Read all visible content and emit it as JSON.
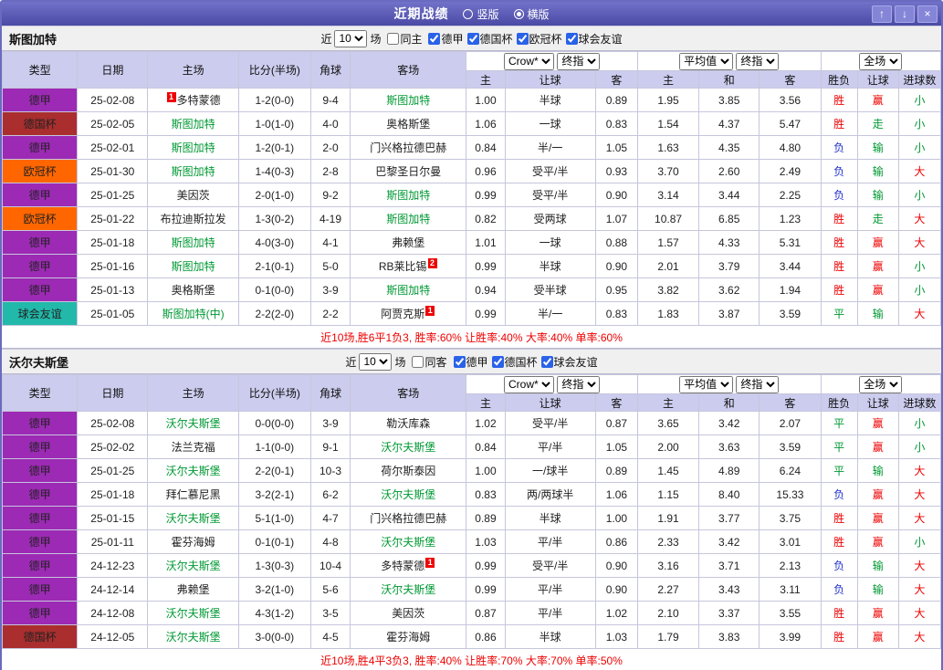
{
  "titlebar": {
    "title": "近期战绩",
    "vertical": "竖版",
    "horizontal": "横版",
    "up": "↑",
    "down": "↓",
    "close": "×"
  },
  "colors": {
    "red": "#ee0000",
    "green": "#009933",
    "blue": "#2233cc",
    "header_lavender": "#ccccee",
    "frame_purple": "#6a6ac0",
    "league": {
      "德甲": "#9c2ab4",
      "德国杯": "#aa2e2e",
      "欧冠杯": "#ff6600",
      "球会友谊": "#22b8aa"
    },
    "result_map": {
      "胜": "#ee0000",
      "平": "#009933",
      "负": "#2233cc",
      "赢": "#ee0000",
      "走": "#009933",
      "输": "#009933",
      "大": "#ee0000",
      "小": "#009933"
    }
  },
  "sections": [
    {
      "team": "斯图加特",
      "filter": {
        "near": "近",
        "count": "10",
        "games": "场",
        "venue": "同主",
        "venue_checked": false,
        "leagues": [
          "德甲",
          "德国杯",
          "欧冠杯",
          "球会友谊"
        ]
      },
      "header": {
        "type": "类型",
        "date": "日期",
        "home": "主场",
        "score": "比分(半场)",
        "corner": "角球",
        "away": "客场",
        "odds_book": "Crow*",
        "odds_stage": "终指",
        "avg_book": "平均值",
        "avg_stage": "终指",
        "scope": "全场",
        "sub": [
          "主",
          "让球",
          "客",
          "主",
          "和",
          "客",
          "胜负",
          "让球",
          "进球数"
        ]
      },
      "rows": [
        {
          "league": "德甲",
          "date": "25-02-08",
          "home": "多特蒙德",
          "home_badge": "1",
          "home_badge_before": true,
          "score": "1-2(0-0)",
          "corner": "9-4",
          "away": "斯图加特",
          "away_green": true,
          "h": "1.00",
          "hcp": "半球",
          "a": "0.89",
          "eh": "1.95",
          "ed": "3.85",
          "ea": "3.56",
          "r1": "胜",
          "r2": "赢",
          "r3": "小"
        },
        {
          "league": "德国杯",
          "date": "25-02-05",
          "home": "斯图加特",
          "home_green": true,
          "score": "1-0(1-0)",
          "corner": "4-0",
          "away": "奥格斯堡",
          "h": "1.06",
          "hcp": "一球",
          "a": "0.83",
          "eh": "1.54",
          "ed": "4.37",
          "ea": "5.47",
          "r1": "胜",
          "r2": "走",
          "r3": "小"
        },
        {
          "league": "德甲",
          "date": "25-02-01",
          "home": "斯图加特",
          "home_green": true,
          "score": "1-2(0-1)",
          "corner": "2-0",
          "away": "门兴格拉德巴赫",
          "h": "0.84",
          "hcp": "半/一",
          "a": "1.05",
          "eh": "1.63",
          "ed": "4.35",
          "ea": "4.80",
          "r1": "负",
          "r2": "输",
          "r3": "小"
        },
        {
          "league": "欧冠杯",
          "date": "25-01-30",
          "home": "斯图加特",
          "home_green": true,
          "score": "1-4(0-3)",
          "corner": "2-8",
          "away": "巴黎圣日尔曼",
          "h": "0.96",
          "hcp": "受平/半",
          "a": "0.93",
          "eh": "3.70",
          "ed": "2.60",
          "ea": "2.49",
          "r1": "负",
          "r2": "输",
          "r3": "大"
        },
        {
          "league": "德甲",
          "date": "25-01-25",
          "home": "美因茨",
          "score": "2-0(1-0)",
          "corner": "9-2",
          "away": "斯图加特",
          "away_green": true,
          "h": "0.99",
          "hcp": "受平/半",
          "a": "0.90",
          "eh": "3.14",
          "ed": "3.44",
          "ea": "2.25",
          "r1": "负",
          "r2": "输",
          "r3": "小"
        },
        {
          "league": "欧冠杯",
          "date": "25-01-22",
          "home": "布拉迪斯拉发",
          "score": "1-3(0-2)",
          "corner": "4-19",
          "away": "斯图加特",
          "away_green": true,
          "h": "0.82",
          "hcp": "受两球",
          "a": "1.07",
          "eh": "10.87",
          "ed": "6.85",
          "ea": "1.23",
          "r1": "胜",
          "r2": "走",
          "r3": "大"
        },
        {
          "league": "德甲",
          "date": "25-01-18",
          "home": "斯图加特",
          "home_green": true,
          "score": "4-0(3-0)",
          "corner": "4-1",
          "away": "弗赖堡",
          "h": "1.01",
          "hcp": "一球",
          "a": "0.88",
          "eh": "1.57",
          "ed": "4.33",
          "ea": "5.31",
          "r1": "胜",
          "r2": "赢",
          "r3": "大"
        },
        {
          "league": "德甲",
          "date": "25-01-16",
          "home": "斯图加特",
          "home_green": true,
          "score": "2-1(0-1)",
          "corner": "5-0",
          "away": "RB莱比锡",
          "away_badge": "2",
          "h": "0.99",
          "hcp": "半球",
          "a": "0.90",
          "eh": "2.01",
          "ed": "3.79",
          "ea": "3.44",
          "r1": "胜",
          "r2": "赢",
          "r3": "小"
        },
        {
          "league": "德甲",
          "date": "25-01-13",
          "home": "奥格斯堡",
          "score": "0-1(0-0)",
          "corner": "3-9",
          "away": "斯图加特",
          "away_green": true,
          "h": "0.94",
          "hcp": "受半球",
          "a": "0.95",
          "eh": "3.82",
          "ed": "3.62",
          "ea": "1.94",
          "r1": "胜",
          "r2": "赢",
          "r3": "小"
        },
        {
          "league": "球会友谊",
          "date": "25-01-05",
          "home": "斯图加特(中)",
          "home_green": true,
          "score": "2-2(2-0)",
          "corner": "2-2",
          "away": "阿贾克斯",
          "away_badge": "1",
          "h": "0.99",
          "hcp": "半/一",
          "a": "0.83",
          "eh": "1.83",
          "ed": "3.87",
          "ea": "3.59",
          "r1": "平",
          "r2": "输",
          "r3": "大"
        }
      ],
      "footer": "近10场,胜6平1负3, 胜率:60% 让胜率:40% 大率:40% 单率:60%"
    },
    {
      "team": "沃尔夫斯堡",
      "filter": {
        "near": "近",
        "count": "10",
        "games": "场",
        "venue": "同客",
        "venue_checked": false,
        "leagues": [
          "德甲",
          "德国杯",
          "球会友谊"
        ]
      },
      "header": {
        "type": "类型",
        "date": "日期",
        "home": "主场",
        "score": "比分(半场)",
        "corner": "角球",
        "away": "客场",
        "odds_book": "Crow*",
        "odds_stage": "终指",
        "avg_book": "平均值",
        "avg_stage": "终指",
        "scope": "全场",
        "sub": [
          "主",
          "让球",
          "客",
          "主",
          "和",
          "客",
          "胜负",
          "让球",
          "进球数"
        ]
      },
      "rows": [
        {
          "league": "德甲",
          "date": "25-02-08",
          "home": "沃尔夫斯堡",
          "home_green": true,
          "score": "0-0(0-0)",
          "corner": "3-9",
          "away": "勒沃库森",
          "h": "1.02",
          "hcp": "受平/半",
          "a": "0.87",
          "eh": "3.65",
          "ed": "3.42",
          "ea": "2.07",
          "r1": "平",
          "r2": "赢",
          "r3": "小"
        },
        {
          "league": "德甲",
          "date": "25-02-02",
          "home": "法兰克福",
          "score": "1-1(0-0)",
          "corner": "9-1",
          "away": "沃尔夫斯堡",
          "away_green": true,
          "h": "0.84",
          "hcp": "平/半",
          "a": "1.05",
          "eh": "2.00",
          "ed": "3.63",
          "ea": "3.59",
          "r1": "平",
          "r2": "赢",
          "r3": "小"
        },
        {
          "league": "德甲",
          "date": "25-01-25",
          "home": "沃尔夫斯堡",
          "home_green": true,
          "score": "2-2(0-1)",
          "corner": "10-3",
          "away": "荷尔斯泰因",
          "h": "1.00",
          "hcp": "一/球半",
          "a": "0.89",
          "eh": "1.45",
          "ed": "4.89",
          "ea": "6.24",
          "r1": "平",
          "r2": "输",
          "r3": "大"
        },
        {
          "league": "德甲",
          "date": "25-01-18",
          "home": "拜仁慕尼黑",
          "score": "3-2(2-1)",
          "corner": "6-2",
          "away": "沃尔夫斯堡",
          "away_green": true,
          "h": "0.83",
          "hcp": "两/两球半",
          "a": "1.06",
          "eh": "1.15",
          "ed": "8.40",
          "ea": "15.33",
          "r1": "负",
          "r2": "赢",
          "r3": "大"
        },
        {
          "league": "德甲",
          "date": "25-01-15",
          "home": "沃尔夫斯堡",
          "home_green": true,
          "score": "5-1(1-0)",
          "corner": "4-7",
          "away": "门兴格拉德巴赫",
          "h": "0.89",
          "hcp": "半球",
          "a": "1.00",
          "eh": "1.91",
          "ed": "3.77",
          "ea": "3.75",
          "r1": "胜",
          "r2": "赢",
          "r3": "大"
        },
        {
          "league": "德甲",
          "date": "25-01-11",
          "home": "霍芬海姆",
          "score": "0-1(0-1)",
          "corner": "4-8",
          "away": "沃尔夫斯堡",
          "away_green": true,
          "h": "1.03",
          "hcp": "平/半",
          "a": "0.86",
          "eh": "2.33",
          "ed": "3.42",
          "ea": "3.01",
          "r1": "胜",
          "r2": "赢",
          "r3": "小"
        },
        {
          "league": "德甲",
          "date": "24-12-23",
          "home": "沃尔夫斯堡",
          "home_green": true,
          "score": "1-3(0-3)",
          "corner": "10-4",
          "away": "多特蒙德",
          "away_badge": "1",
          "h": "0.99",
          "hcp": "受平/半",
          "a": "0.90",
          "eh": "3.16",
          "ed": "3.71",
          "ea": "2.13",
          "r1": "负",
          "r2": "输",
          "r3": "大"
        },
        {
          "league": "德甲",
          "date": "24-12-14",
          "home": "弗赖堡",
          "score": "3-2(1-0)",
          "corner": "5-6",
          "away": "沃尔夫斯堡",
          "away_green": true,
          "h": "0.99",
          "hcp": "平/半",
          "a": "0.90",
          "eh": "2.27",
          "ed": "3.43",
          "ea": "3.11",
          "r1": "负",
          "r2": "输",
          "r3": "大"
        },
        {
          "league": "德甲",
          "date": "24-12-08",
          "home": "沃尔夫斯堡",
          "home_green": true,
          "score": "4-3(1-2)",
          "corner": "3-5",
          "away": "美因茨",
          "h": "0.87",
          "hcp": "平/半",
          "a": "1.02",
          "eh": "2.10",
          "ed": "3.37",
          "ea": "3.55",
          "r1": "胜",
          "r2": "赢",
          "r3": "大"
        },
        {
          "league": "德国杯",
          "date": "24-12-05",
          "home": "沃尔夫斯堡",
          "home_green": true,
          "score": "3-0(0-0)",
          "corner": "4-5",
          "away": "霍芬海姆",
          "h": "0.86",
          "hcp": "半球",
          "a": "1.03",
          "eh": "1.79",
          "ed": "3.83",
          "ea": "3.99",
          "r1": "胜",
          "r2": "赢",
          "r3": "大"
        }
      ],
      "footer": "近10场,胜4平3负3, 胜率:40% 让胜率:70% 大率:70% 单率:50%"
    }
  ]
}
